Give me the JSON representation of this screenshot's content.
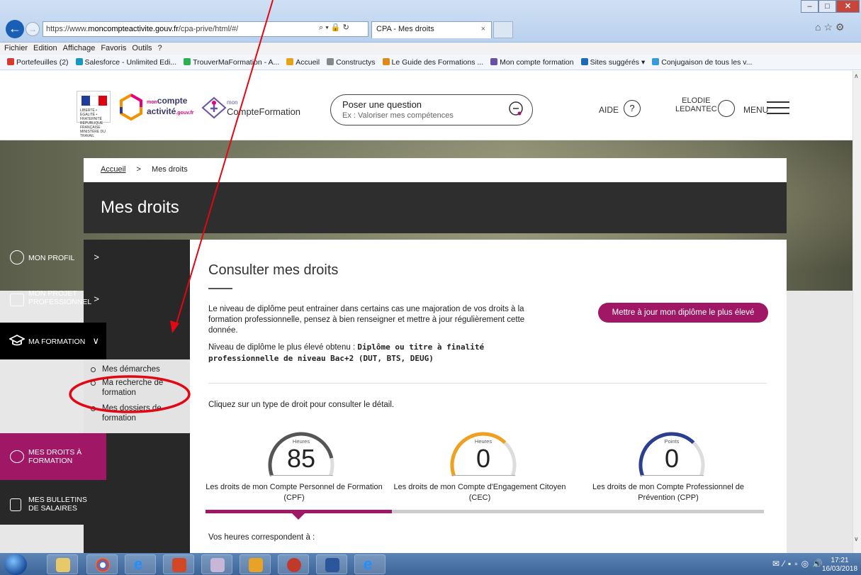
{
  "browser": {
    "url_prefix": "https://www.",
    "url_domain": "moncompteactivite.gouv.fr",
    "url_path": "/cpa-prive/html/#/",
    "tab_title": "CPA - Mes droits",
    "tab_close": "×",
    "menu": [
      "Fichier",
      "Edition",
      "Affichage",
      "Favoris",
      "Outils",
      "?"
    ],
    "favorites": [
      {
        "label": "Portefeuilles (2)",
        "color": "#d9392e"
      },
      {
        "label": "Salesforce - Unlimited Edi...",
        "color": "#1798c1"
      },
      {
        "label": "TrouverMaFormation - A...",
        "color": "#2fae52"
      },
      {
        "label": "Accueil",
        "color": "#e5a31a"
      },
      {
        "label": "Constructys",
        "color": "#888888"
      },
      {
        "label": "Le Guide des Formations ...",
        "color": "#e08a1e"
      },
      {
        "label": "Mon compte formation",
        "color": "#6a52a3"
      },
      {
        "label": "Sites suggérés ▾",
        "color": "#1f6ab5"
      },
      {
        "label": "Conjugaison de tous les v...",
        "color": "#3a9ad9"
      }
    ]
  },
  "header": {
    "flag_caption": "LIBERTÉ • ÉGALITÉ • FRATERNITÉ RÉPUBLIQUE FRANÇAISE MINISTÈRE DU TRAVAIL",
    "logo1_small": "mon",
    "logo1_big": "compte",
    "logo1_line2": "activité",
    "logo1_suffix": ".gouv.fr",
    "logo2_small": "mon",
    "logo2_text": "CompteFormation",
    "ask_title": "Poser une question",
    "ask_placeholder": "Ex : Valoriser mes compétences",
    "aide": "AIDE",
    "aide_icon": "?",
    "user_first": "ELODIE",
    "user_last": "LEDANTEC",
    "menu": "MENU"
  },
  "breadcrumb": {
    "home": "Accueil",
    "sep": ">",
    "current": "Mes droits"
  },
  "page_title": "Mes droits",
  "sidebar": {
    "profil": "MON PROFIL",
    "projet": "MON PROJET PROFESSIONNEL",
    "formation": "MA FORMATION",
    "sub": [
      "Mes démarches",
      "Ma recherche de formation",
      "Mes dossiers de formation"
    ],
    "droits": "MES DROITS À FORMATION",
    "bulletins": "MES BULLETINS DE SALAIRES",
    "arrow_right": ">",
    "arrow_down": "∨"
  },
  "content": {
    "subtitle": "Consulter mes droits",
    "paragraph": "Le niveau de diplôme peut entrainer dans certains cas une majoration de vos droits à la formation professionnelle, pensez à bien renseigner et mettre à jour régulièrement cette donnée.",
    "niveau_label": "Niveau de diplôme le plus élevé obtenu :",
    "niveau_value": "Diplôme ou titre à finalité professionnelle de niveau Bac+2 (DUT, BTS, DEUG)",
    "update_button": "Mettre à jour mon diplôme le plus élevé",
    "click_hint": "Cliquez sur un type de droit pour consulter le détail.",
    "gauges": [
      {
        "unit": "Heures",
        "value": "85",
        "caption": "Les droits de mon Compte Personnel de Formation (CPF)",
        "color": "#555555",
        "fill": 0.85
      },
      {
        "unit": "Heures",
        "value": "0",
        "caption": "Les droits de mon Compte d'Engagement Citoyen (CEC)",
        "color": "#f0a020",
        "fill": 0.7
      },
      {
        "unit": "Points",
        "value": "0",
        "caption": "Les droits de mon Compte Professionnel de Prévention (CPP)",
        "color": "#2c3e8f",
        "fill": 0.7
      }
    ],
    "vos_heures": "Vos heures correspondent à :"
  },
  "taskbar": {
    "time": "17:21",
    "date": "16/03/2018"
  },
  "colors": {
    "accent": "#a01765",
    "annotation": "#e30613"
  }
}
